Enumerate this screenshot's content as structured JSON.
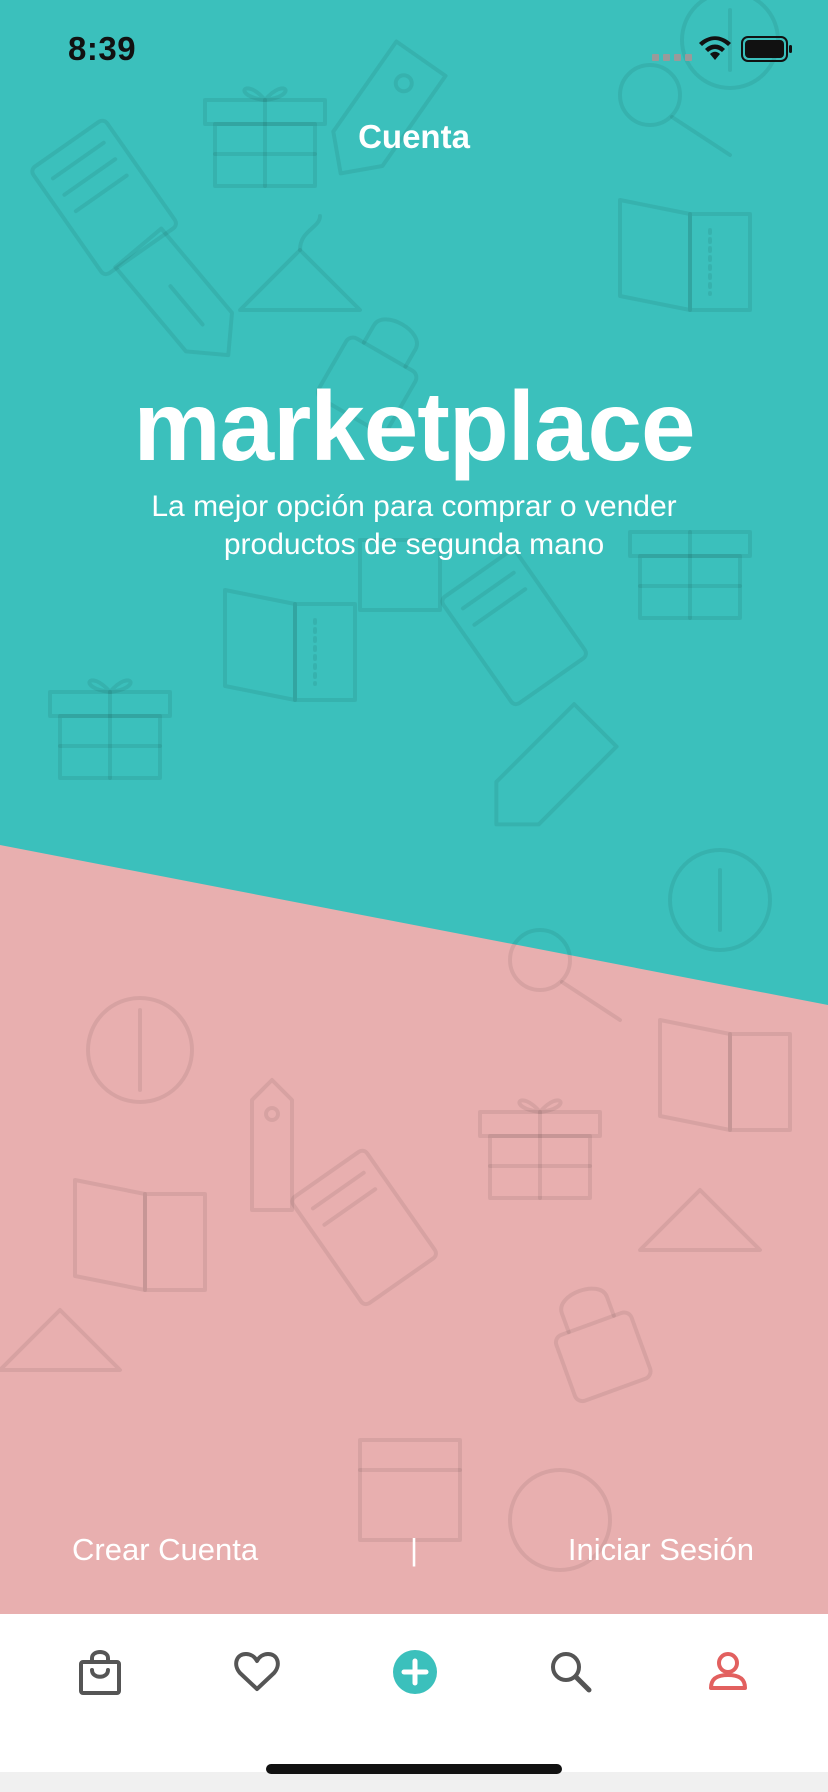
{
  "status_bar": {
    "time": "8:39"
  },
  "nav": {
    "title": "Cuenta"
  },
  "hero": {
    "brand": "marketplace",
    "tagline": "La mejor opción para comprar o vender productos de segunda mano"
  },
  "auth": {
    "create_label": "Crear Cuenta",
    "separator": "|",
    "login_label": "Iniciar Sesión"
  },
  "tabs": [
    {
      "icon": "shopping-bag-icon",
      "active": false
    },
    {
      "icon": "heart-icon",
      "active": false
    },
    {
      "icon": "add-circle-icon",
      "active": false
    },
    {
      "icon": "search-icon",
      "active": false
    },
    {
      "icon": "profile-icon",
      "active": true
    }
  ],
  "colors": {
    "teal": "#3bc0bc",
    "pink": "#e8afaf",
    "tab_inactive": "#555555",
    "tab_active": "#e2605f",
    "add_button": "#3bc0bc"
  }
}
